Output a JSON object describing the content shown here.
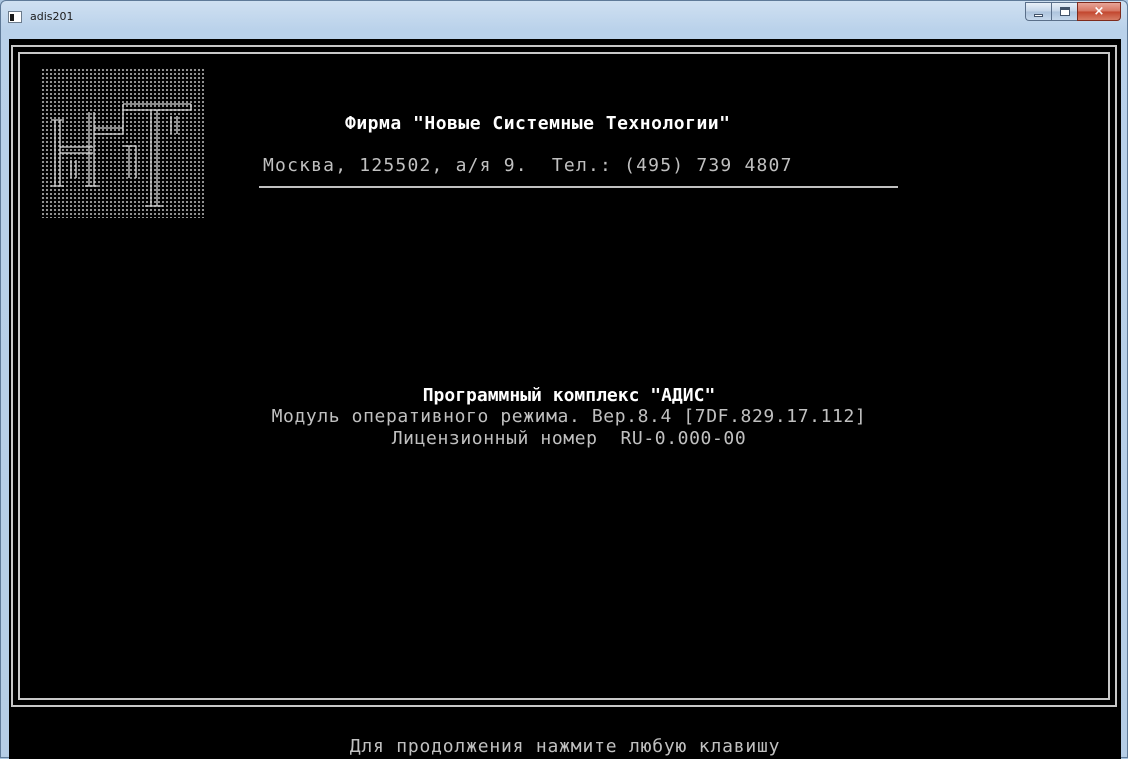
{
  "window": {
    "title": "adis201",
    "minimize_icon": "minimize-icon",
    "maximize_icon": "maximize-icon",
    "close_glyph": "×"
  },
  "console": {
    "logo_icon": "nst-logo-icon",
    "company_name": "Фирма \"Новые Системные Технологии\"",
    "address": "Москва, 125502, а/я 9.  Тел.: (495) 739 4807",
    "product_title": "Программный комплекс \"АДИС\"",
    "module_line": "Модуль оперативного режима. Вер.8.4 [7DF.829.17.112]",
    "license_line": "Лицензионный номер  RU-0.000-00",
    "status_prompt": "Для продолжения нажмите любую клавишу"
  },
  "colors": {
    "console_background": "#000000",
    "console_text": "#c0c0c0",
    "highlight_text": "#ffffff",
    "frame": "#c8c8c8",
    "titlebar": "#b9d1ea"
  }
}
